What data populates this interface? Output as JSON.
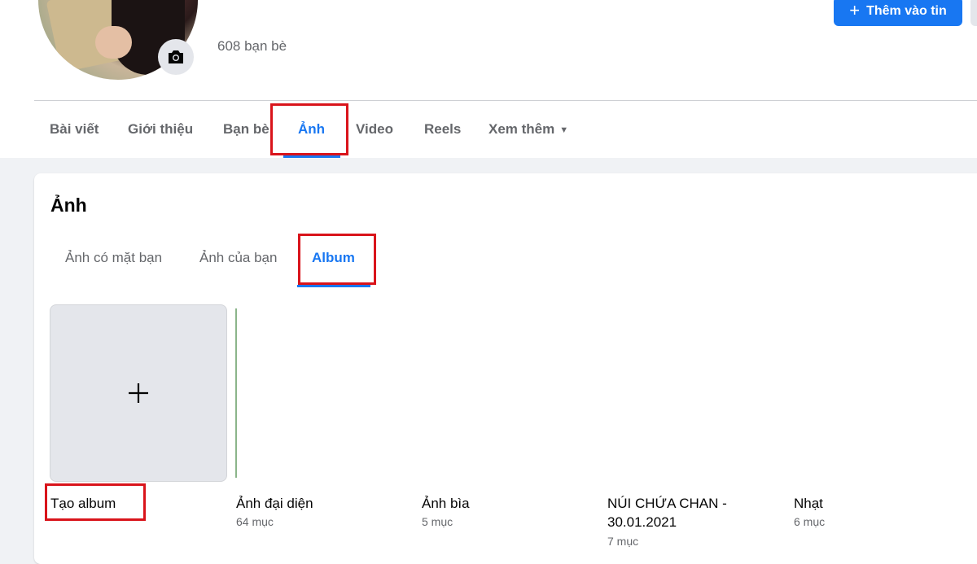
{
  "header": {
    "friends_count": "608 bạn bè",
    "add_story_label": "Thêm vào tin"
  },
  "profile_tabs": [
    {
      "label": "Bài viết"
    },
    {
      "label": "Giới thiệu"
    },
    {
      "label": "Bạn bè"
    },
    {
      "label": "Ảnh"
    },
    {
      "label": "Video"
    },
    {
      "label": "Reels"
    },
    {
      "label": "Xem thêm"
    }
  ],
  "photos": {
    "title": "Ảnh",
    "subtabs": [
      {
        "label": "Ảnh có mặt bạn"
      },
      {
        "label": "Ảnh của bạn"
      },
      {
        "label": "Album"
      }
    ],
    "create_album_label": "Tạo album",
    "albums": [
      {
        "name": "Ảnh đại diện",
        "count": "64 mục"
      },
      {
        "name": "Ảnh bìa",
        "count": "5 mục"
      },
      {
        "name": "NÚI CHỨA CHAN -",
        "name_line2": "30.01.2021",
        "count": "7 mục"
      },
      {
        "name": "Nhạt",
        "count": "6 mục"
      }
    ]
  },
  "icons": {
    "camera": "camera-icon",
    "plus": "plus-icon",
    "caret": "caret-down-icon"
  },
  "colors": {
    "accent": "#1877f2",
    "highlight": "#d9141b"
  }
}
